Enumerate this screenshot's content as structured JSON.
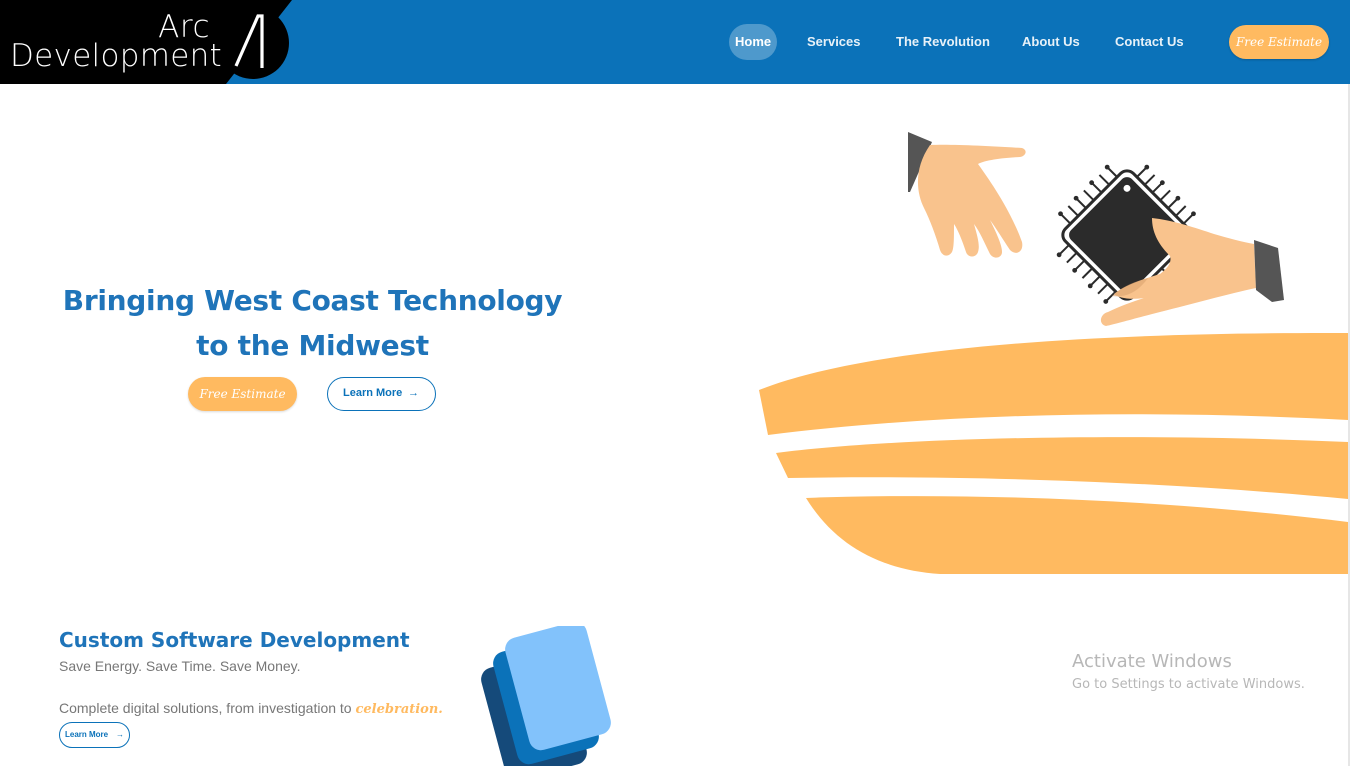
{
  "brand": {
    "line1": "Arc",
    "line2": "Development",
    "logo_icon": "arc-a-logo"
  },
  "nav": {
    "tabs": [
      {
        "label": "Home",
        "active": true
      },
      {
        "label": "Services",
        "active": false
      },
      {
        "label": "The Revolution",
        "active": false
      },
      {
        "label": "About Us",
        "active": false
      },
      {
        "label": "Contact Us",
        "active": false
      }
    ],
    "cta_label": "Free Estimate"
  },
  "hero": {
    "title_line1": "Bringing West Coast Technology",
    "title_line2": "to the Midwest",
    "estimate_label": "Free Estimate",
    "learn_label": "Learn More",
    "illustration": "hands-exchanging-chip"
  },
  "services": {
    "title": "Custom Software Development",
    "subtitle": "Save Energy. Save Time. Save Money.",
    "description": "Complete digital solutions, from investigation to",
    "highlight": "celebration.",
    "learn_label": "Learn More",
    "icon": "stacked-cards-icon"
  },
  "watermark": {
    "title": "Activate Windows",
    "subtitle": "Go to Settings to activate Windows."
  },
  "colors": {
    "primary_blue": "#0b72b9",
    "accent_orange": "#ffba60",
    "hand_skin": "#f9c38d",
    "chip_dark": "#2b2b2b",
    "sleeve_gray": "#555555"
  }
}
